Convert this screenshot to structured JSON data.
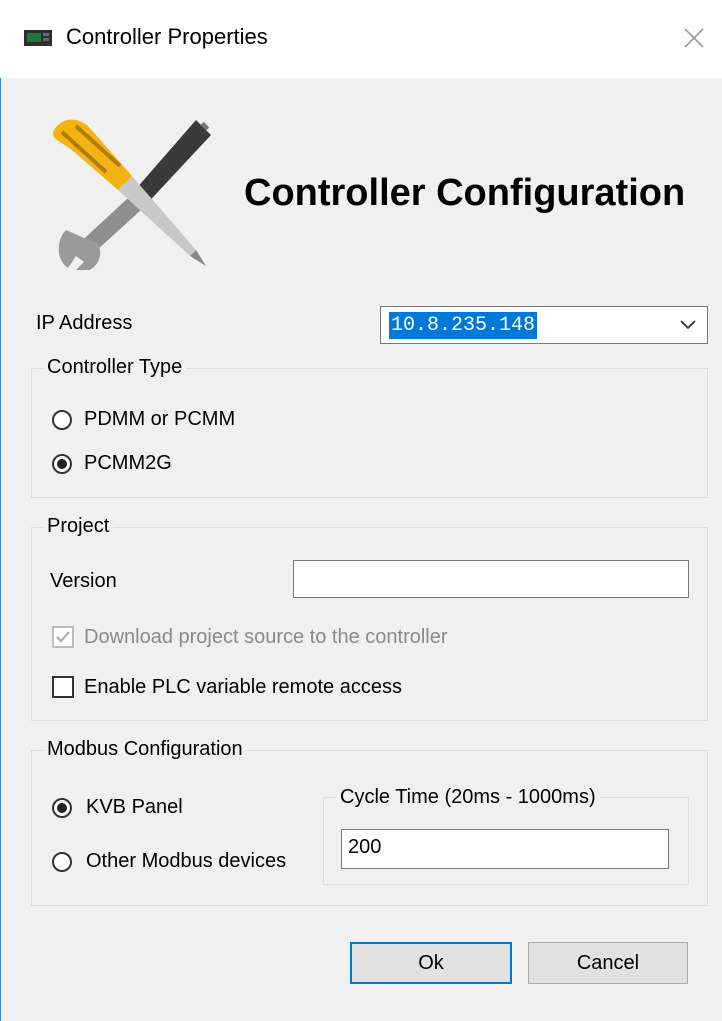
{
  "window": {
    "title": "Controller Properties",
    "icon": "controller-icon",
    "close_icon": "close-icon"
  },
  "header": {
    "heading": "Controller Configuration",
    "image": "screwdriver-wrench-icon"
  },
  "ip": {
    "label": "IP Address",
    "value": "10.8.235.148"
  },
  "controller_type": {
    "title": "Controller Type",
    "options": [
      {
        "label": "PDMM or PCMM",
        "checked": false
      },
      {
        "label": "PCMM2G",
        "checked": true
      }
    ]
  },
  "project": {
    "title": "Project",
    "version_label": "Version",
    "version_value": "",
    "download_label": "Download project source to the controller",
    "download_checked": true,
    "download_enabled": false,
    "remote_access_label": "Enable PLC variable remote access",
    "remote_access_checked": false
  },
  "modbus": {
    "title": "Modbus Configuration",
    "options": [
      {
        "label": "KVB Panel",
        "checked": true
      },
      {
        "label": "Other Modbus devices",
        "checked": false
      }
    ],
    "cycle_title": "Cycle Time (20ms - 1000ms)",
    "cycle_value": "200"
  },
  "buttons": {
    "ok": "Ok",
    "cancel": "Cancel"
  },
  "colors": {
    "accent": "#0078d7",
    "border": "#dcdcdc",
    "background": "#f0f0f0"
  }
}
